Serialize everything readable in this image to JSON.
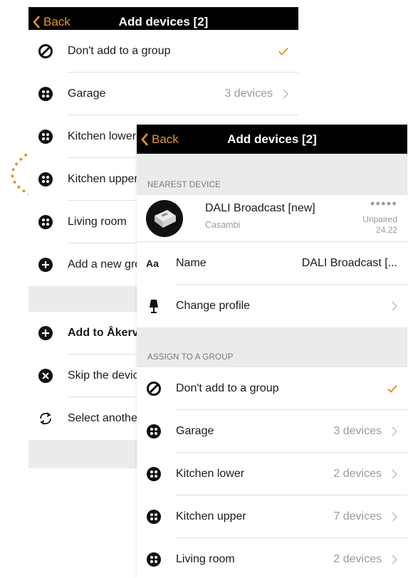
{
  "back_screen": {
    "nav": {
      "back_label": "Back",
      "title": "Add devices [2]"
    },
    "rows": [
      {
        "label": "Don't add to a group",
        "value": "",
        "icon": "no-group-icon",
        "checked": true
      },
      {
        "label": "Garage",
        "value": "3 devices",
        "icon": "group-icon"
      },
      {
        "label": "Kitchen lower",
        "value": "",
        "icon": "group-icon"
      },
      {
        "label": "Kitchen upper",
        "value": "",
        "icon": "group-icon"
      },
      {
        "label": "Living room",
        "value": "",
        "icon": "group-icon"
      },
      {
        "label": "Add a new group",
        "value": "",
        "icon": "plus-circle-icon"
      }
    ],
    "actions": [
      {
        "label": "Add to Åkervägen",
        "icon": "plus-circle-icon",
        "bold": true
      },
      {
        "label": "Skip the device",
        "icon": "skip-icon"
      },
      {
        "label": "Select another device",
        "icon": "refresh-icon"
      }
    ]
  },
  "front_screen": {
    "nav": {
      "back_label": "Back",
      "title": "Add devices [2]"
    },
    "nearest_header": "NEAREST DEVICE",
    "device": {
      "name": "DALI Broadcast [new]",
      "vendor": "Casambi",
      "signal": "●●●●●",
      "status": "Unpaired",
      "version": "24.22"
    },
    "name_row": {
      "icon_text": "Aa",
      "label": "Name",
      "value": "DALI Broadcast [..."
    },
    "profile_row": {
      "label": "Change profile"
    },
    "group_header": "ASSIGN TO A GROUP",
    "groups": [
      {
        "label": "Don't add to a group",
        "value": "",
        "icon": "no-group-icon",
        "checked": true
      },
      {
        "label": "Garage",
        "value": "3 devices",
        "icon": "group-icon"
      },
      {
        "label": "Kitchen lower",
        "value": "2 devices",
        "icon": "group-icon"
      },
      {
        "label": "Kitchen upper",
        "value": "7 devices",
        "icon": "group-icon"
      },
      {
        "label": "Living room",
        "value": "2 devices",
        "icon": "group-icon"
      }
    ]
  },
  "colors": {
    "accent": "#e8951c",
    "navbar": "#000000",
    "section_bg": "#ebebeb",
    "value_text": "#9a9a9a"
  }
}
